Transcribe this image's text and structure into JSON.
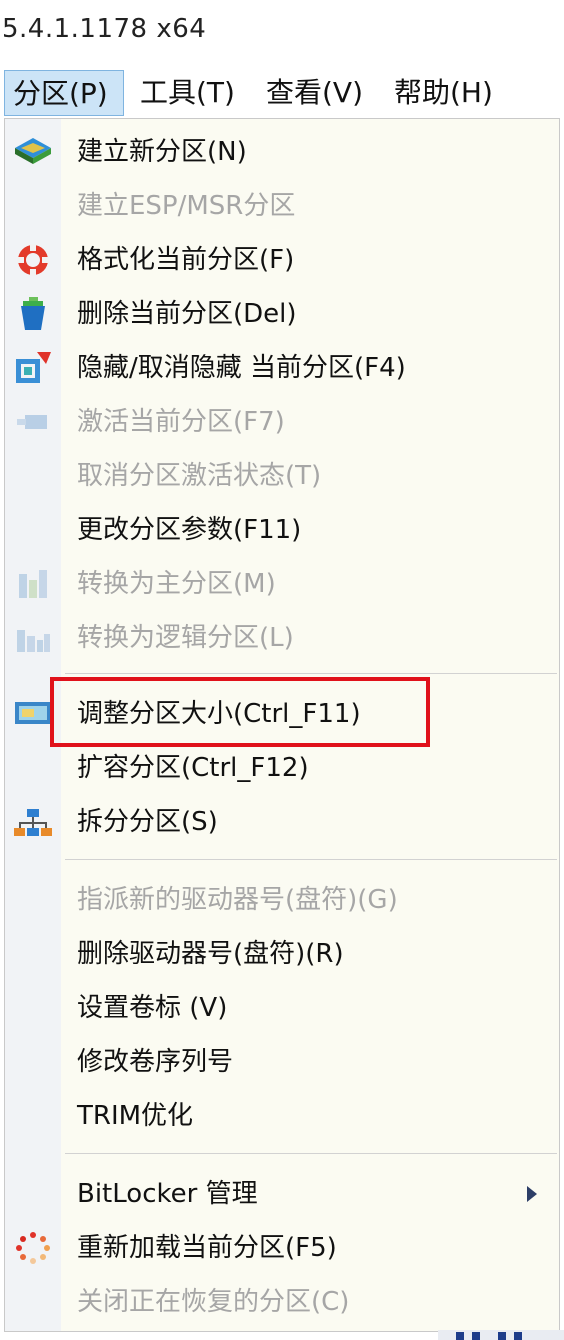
{
  "version": "5.4.1.1178 x64",
  "menubar": {
    "items": [
      {
        "label": "分区(P)"
      },
      {
        "label": "工具(T)"
      },
      {
        "label": "查看(V)"
      },
      {
        "label": "帮助(H)"
      }
    ]
  },
  "menu": {
    "items": [
      {
        "label": "建立新分区(N)",
        "enabled": true,
        "icon": "layers-icon"
      },
      {
        "label": "建立ESP/MSR分区",
        "enabled": false,
        "icon": ""
      },
      {
        "label": "格式化当前分区(F)",
        "enabled": true,
        "icon": "lifebuoy-icon"
      },
      {
        "label": "删除当前分区(Del)",
        "enabled": true,
        "icon": "trash-icon"
      },
      {
        "label": "隐藏/取消隐藏 当前分区(F4)",
        "enabled": true,
        "icon": "hide-partition-icon"
      },
      {
        "label": "激活当前分区(F7)",
        "enabled": false,
        "icon": "activate-icon"
      },
      {
        "label": "取消分区激活状态(T)",
        "enabled": false,
        "icon": ""
      },
      {
        "label": "更改分区参数(F11)",
        "enabled": true,
        "icon": ""
      },
      {
        "label": "转换为主分区(M)",
        "enabled": false,
        "icon": "convert-primary-icon"
      },
      {
        "label": "转换为逻辑分区(L)",
        "enabled": false,
        "icon": "convert-logical-icon"
      },
      {
        "label": "调整分区大小(Ctrl_F11)",
        "enabled": true,
        "icon": "resize-icon"
      },
      {
        "label": "扩容分区(Ctrl_F12)",
        "enabled": true,
        "icon": ""
      },
      {
        "label": "拆分分区(S)",
        "enabled": true,
        "icon": "split-icon"
      },
      {
        "label": "指派新的驱动器号(盘符)(G)",
        "enabled": false,
        "icon": ""
      },
      {
        "label": "删除驱动器号(盘符)(R)",
        "enabled": true,
        "icon": ""
      },
      {
        "label": "设置卷标 (V)",
        "enabled": true,
        "icon": ""
      },
      {
        "label": "修改卷序列号",
        "enabled": true,
        "icon": ""
      },
      {
        "label": "TRIM优化",
        "enabled": true,
        "icon": ""
      },
      {
        "label": "BitLocker 管理",
        "enabled": true,
        "icon": "",
        "submenu": true
      },
      {
        "label": "重新加载当前分区(F5)",
        "enabled": true,
        "icon": "reload-icon"
      },
      {
        "label": "关闭正在恢复的分区(C)",
        "enabled": false,
        "icon": ""
      }
    ]
  },
  "colors": {
    "highlight_border": "#e0111b",
    "menubar_active_bg": "#cce4f7",
    "disabled_text": "#a6a6a6"
  }
}
